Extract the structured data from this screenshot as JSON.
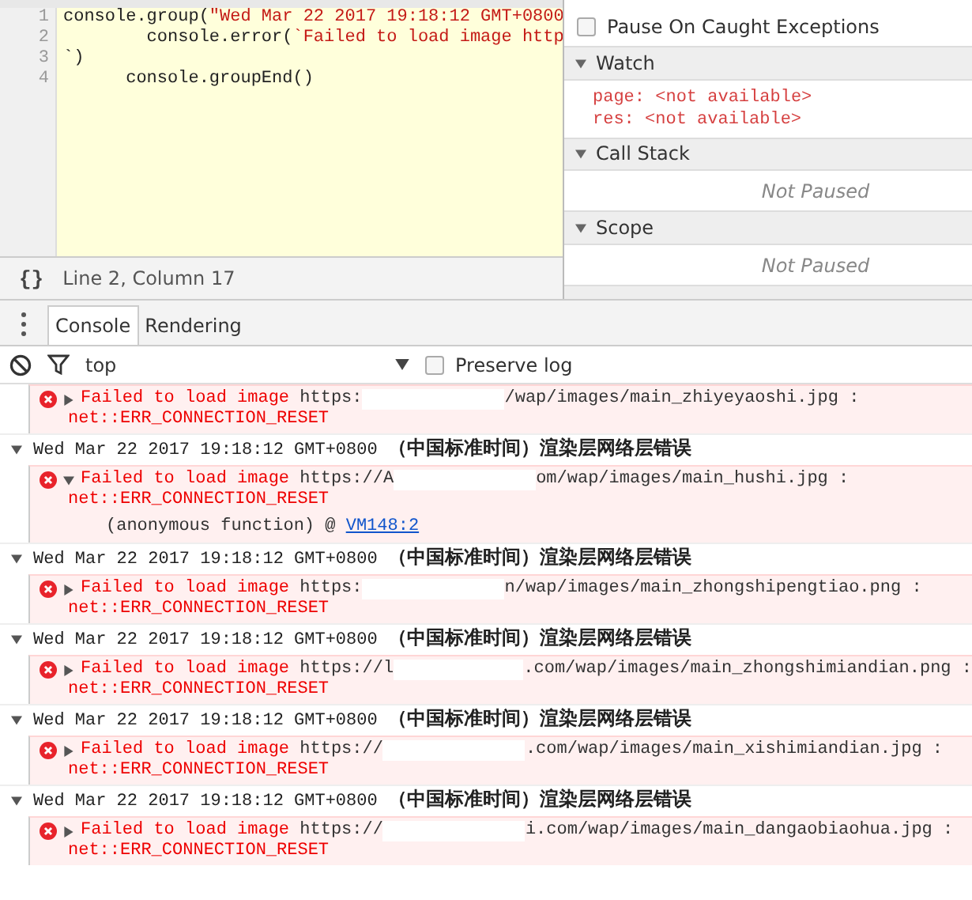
{
  "editor": {
    "lines": [
      {
        "number": "1",
        "segments": [
          {
            "kind": "code",
            "text": "console.group("
          },
          {
            "kind": "string",
            "text": "\"Wed Mar 22 2017 19:18:12 GMT+0800"
          }
        ]
      },
      {
        "number": "2",
        "segments": [
          {
            "kind": "code",
            "text": "        console.error("
          },
          {
            "kind": "string",
            "text": "`Failed to load image http"
          }
        ]
      },
      {
        "number": "3",
        "segments": [
          {
            "kind": "code",
            "text": "`)"
          }
        ]
      },
      {
        "number": "4",
        "segments": [
          {
            "kind": "code",
            "text": "      console.groupEnd()"
          }
        ]
      }
    ],
    "status": "Line 2, Column 17",
    "format_button": "{}"
  },
  "sidebar": {
    "pause_on_caught": {
      "label": "Pause On Caught Exceptions",
      "checked": false
    },
    "sections": [
      {
        "title": "Watch",
        "expanded": true,
        "kind": "watch",
        "items": [
          {
            "name": "page:",
            "value": "<not available>"
          },
          {
            "name": "res:",
            "value": "<not available>"
          }
        ]
      },
      {
        "title": "Call Stack",
        "expanded": true,
        "kind": "message",
        "message": "Not Paused"
      },
      {
        "title": "Scope",
        "expanded": true,
        "kind": "message",
        "message": "Not Paused"
      }
    ]
  },
  "drawer": {
    "tabs": [
      {
        "label": "Console",
        "selected": true
      },
      {
        "label": "Rendering",
        "selected": false
      }
    ],
    "context": "top",
    "preserve_log": {
      "label": "Preserve log",
      "checked": false
    },
    "log": [
      {
        "kind": "error",
        "expanded": false,
        "message": "Failed to load image",
        "url_start": "https:",
        "url_end": "/wap/images/main_zhiyeyaoshi.jpg :",
        "detail": "net::ERR_CONNECTION_RESET"
      },
      {
        "kind": "group",
        "expanded": true,
        "title": "Wed Mar 22 2017 19:18:12 GMT+0800 **（中国标准时间）渲染层网络层错误**",
        "children": [
          {
            "kind": "error",
            "expanded": true,
            "message": "Failed to load image",
            "url_start": "https://A",
            "url_end": "om/wap/images/main_hushi.jpg :",
            "detail": "net::ERR_CONNECTION_RESET",
            "stack": [
              {
                "function": "(anonymous function) @",
                "link": "VM148:2"
              }
            ]
          }
        ]
      },
      {
        "kind": "group",
        "expanded": true,
        "title": "Wed Mar 22 2017 19:18:12 GMT+0800 **（中国标准时间）渲染层网络层错误**",
        "children": [
          {
            "kind": "error",
            "expanded": false,
            "message": "Failed to load image",
            "url_start": "https:",
            "url_end": "n/wap/images/main_zhongshipengtiao.png :",
            "detail": "net::ERR_CONNECTION_RESET"
          }
        ]
      },
      {
        "kind": "group",
        "expanded": true,
        "title": "Wed Mar 22 2017 19:18:12 GMT+0800 **（中国标准时间）渲染层网络层错误**",
        "children": [
          {
            "kind": "error",
            "expanded": false,
            "message": "Failed to load image",
            "url_start": "https://l",
            "url_end": ".com/wap/images/main_zhongshimiandian.png :",
            "detail": "net::ERR_CONNECTION_RESET"
          }
        ]
      },
      {
        "kind": "group",
        "expanded": true,
        "title": "Wed Mar 22 2017 19:18:12 GMT+0800 **（中国标准时间）渲染层网络层错误**",
        "children": [
          {
            "kind": "error",
            "expanded": false,
            "message": "Failed to load image",
            "url_start": "https://",
            "url_end": ".com/wap/images/main_xishimiandian.jpg :",
            "detail": "net::ERR_CONNECTION_RESET"
          }
        ]
      },
      {
        "kind": "group",
        "expanded": true,
        "title": "Wed Mar 22 2017 19:18:12 GMT+0800 **（中国标准时间）渲染层网络层错误**",
        "children": [
          {
            "kind": "error",
            "expanded": false,
            "message": "Failed to load image",
            "url_start": "https://",
            "url_end": "i.com/wap/images/main_dangaobiaohua.jpg :",
            "detail": "net::ERR_CONNECTION_RESET"
          }
        ]
      }
    ]
  }
}
